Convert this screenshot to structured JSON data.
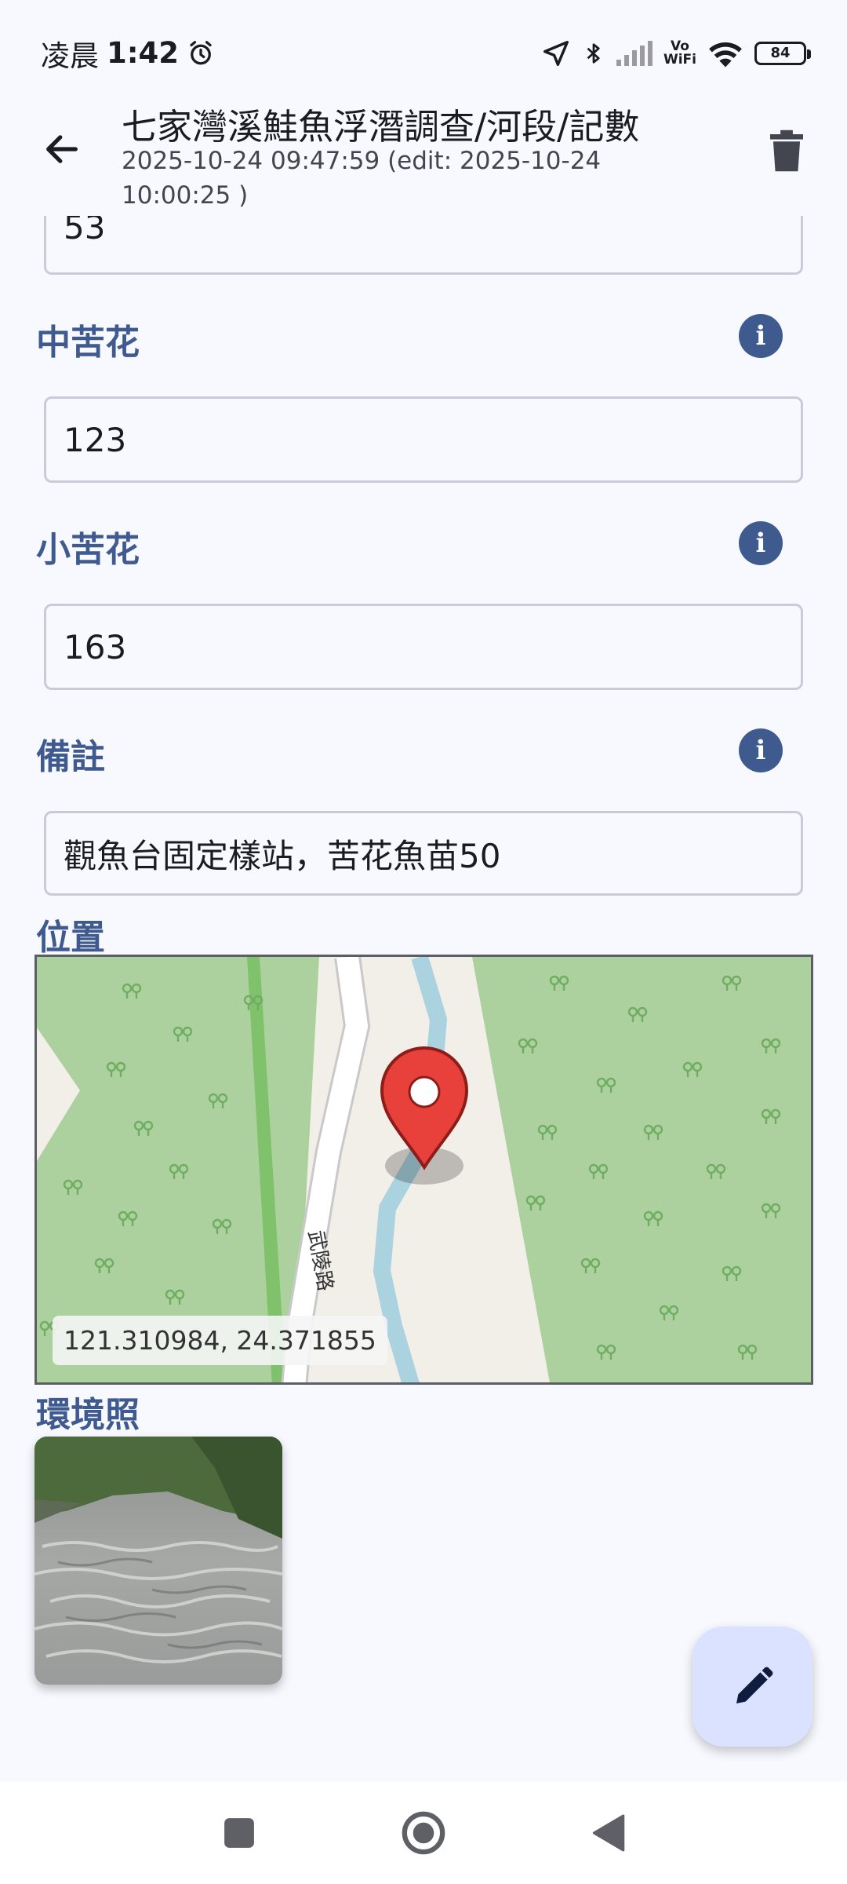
{
  "status": {
    "time_prefix": "凌晨",
    "time": "1:42",
    "vowifi_top": "Vo",
    "vowifi_bottom": "WiFi",
    "battery": "84"
  },
  "header": {
    "title": "七家灣溪鮭魚浮潛調查/河段/記數",
    "subtitle": "2025-10-24 09:47:59 (edit: 2025-10-24 10:00:25 )"
  },
  "fields": {
    "partial_value": "53",
    "medium": {
      "label": "中苦花",
      "value": "123"
    },
    "small": {
      "label": "小苦花",
      "value": "163"
    },
    "note": {
      "label": "備註",
      "value": "觀魚台固定樣站，苦花魚苗50"
    }
  },
  "location": {
    "label": "位置",
    "road_name": "武陵路",
    "coordinates": "121.310984, 24.371855"
  },
  "environment": {
    "label": "環境照"
  },
  "icons": {
    "info": "i",
    "back": "arrow-left-icon",
    "delete": "trash-icon",
    "edit": "pencil-icon"
  },
  "colors": {
    "accent": "#3e5a8e",
    "fab": "#dae2ff",
    "marker": "#e8413c"
  }
}
